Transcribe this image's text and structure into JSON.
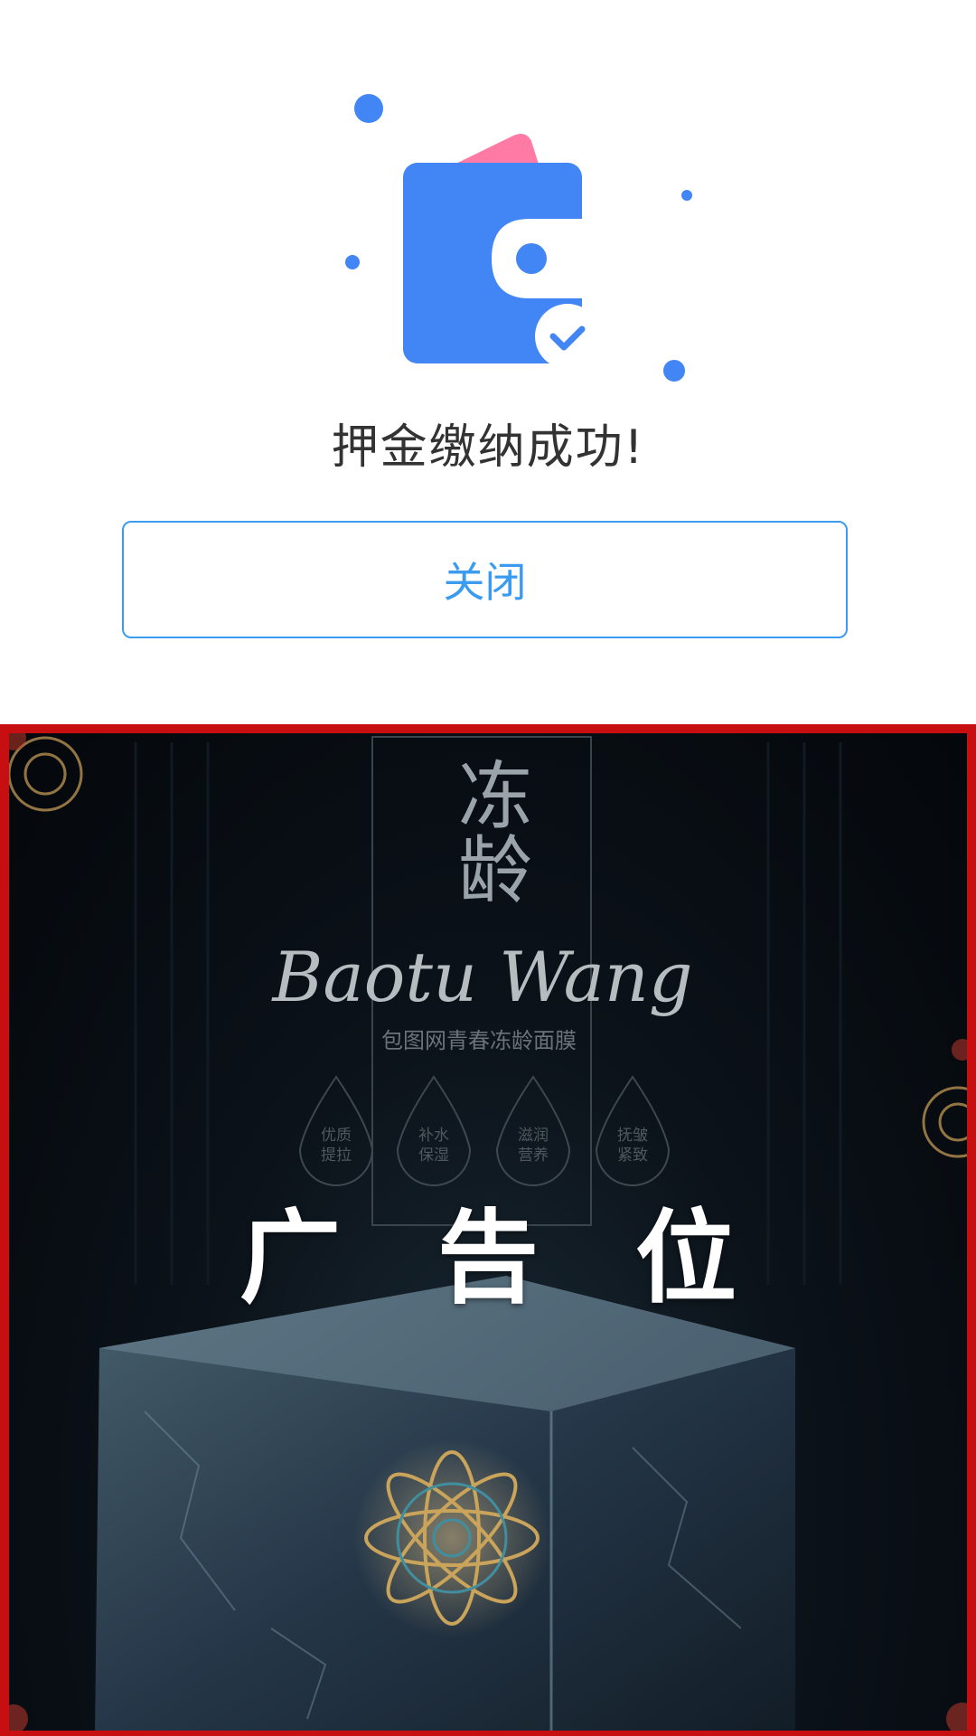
{
  "result": {
    "title": "押金缴纳成功!",
    "close_label": "关闭"
  },
  "colors": {
    "accent": "#3b9cef",
    "wallet_blue": "#4285f4",
    "card_pink": "#ff7aa5",
    "ad_border": "#c70e10"
  },
  "icons": {
    "wallet": "wallet-check-icon"
  },
  "ad": {
    "label": "广 告 位",
    "poster_title": "冻龄",
    "poster_script": "Baotu Wang",
    "poster_subtitle": "包图网青春冻龄面膜",
    "badges": [
      "优质\n提拉",
      "补水\n保湿",
      "滋润\n营养",
      "抚皱\n紧致"
    ]
  }
}
